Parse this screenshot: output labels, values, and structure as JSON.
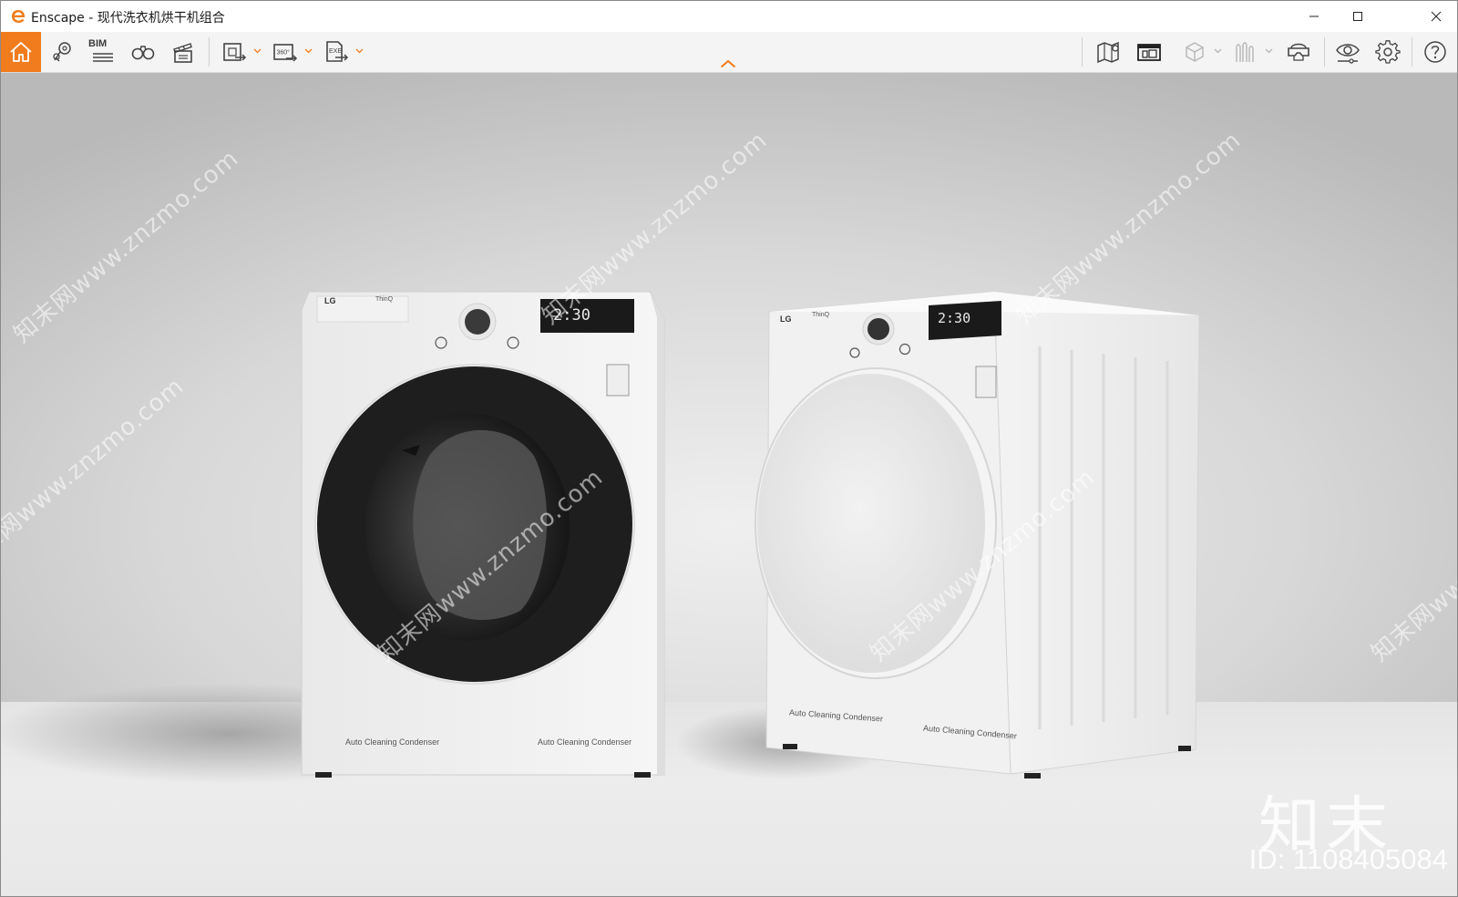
{
  "window": {
    "app_name": "Enscape",
    "separator": " - ",
    "document_title": "现代洗衣机烘干机组合",
    "controls": [
      "minimize-icon",
      "maximize-icon",
      "close-icon"
    ]
  },
  "toolbar": {
    "bim_label": "BIM",
    "left_tools": [
      "home-icon",
      "views-icon",
      "bim-icon",
      "binoculars-icon",
      "clapperboard-icon"
    ],
    "export_tools": [
      "screenshot-export-icon",
      "panorama-360-export-icon",
      "exe-export-icon"
    ],
    "panorama_label": "360°",
    "exe_label": "EXE",
    "right_tools": [
      "map-icon",
      "sketch-mode-icon",
      "cube-icon",
      "walk-icon",
      "vr-headset-icon",
      "visual-settings-icon",
      "settings-gear-icon",
      "help-icon"
    ],
    "accent_color": "#f07c1e"
  },
  "viewport": {
    "watermark_text": "知末网www.znzmo.com",
    "brand_mark": "知末",
    "brand_id": "ID: 1108405084",
    "washer": {
      "brand": "LG",
      "model": "ThinQ",
      "display": "2:30",
      "footer_left": "Auto Cleaning Condenser",
      "footer_right": "Auto Cleaning Condenser"
    },
    "dryer": {
      "brand": "LG",
      "model": "ThinQ",
      "display": "2:30",
      "footer_left": "Auto Cleaning Condenser",
      "footer_right": "Auto Cleaning Condenser"
    }
  }
}
